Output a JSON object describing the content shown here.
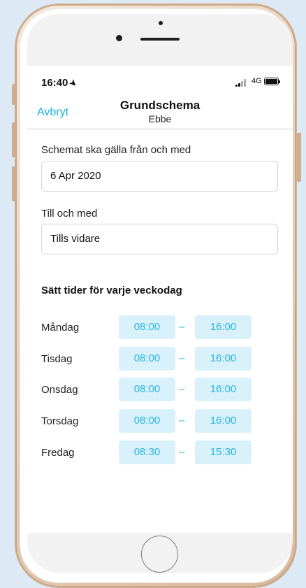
{
  "status_bar": {
    "time": "16:40",
    "network": "4G"
  },
  "nav": {
    "cancel_label": "Avbryt",
    "title": "Grundschema",
    "subtitle": "Ebbe"
  },
  "form": {
    "start_label": "Schemat ska gälla från och med",
    "start_value": "6 Apr 2020",
    "end_label": "Till och med",
    "end_value": "Tills vidare"
  },
  "schedule": {
    "title": "Sätt tider för varje veckodag",
    "separator": "–",
    "days": [
      {
        "day": "Måndag",
        "from": "08:00",
        "to": "16:00"
      },
      {
        "day": "Tisdag",
        "from": "08:00",
        "to": "16:00"
      },
      {
        "day": "Onsdag",
        "from": "08:00",
        "to": "16:00"
      },
      {
        "day": "Torsdag",
        "from": "08:00",
        "to": "16:00"
      },
      {
        "day": "Fredag",
        "from": "08:30",
        "to": "15:30"
      }
    ]
  },
  "colors": {
    "accent": "#1ab2e0",
    "time_bg": "#d9f1fa",
    "page_bg": "#dde9f5"
  }
}
